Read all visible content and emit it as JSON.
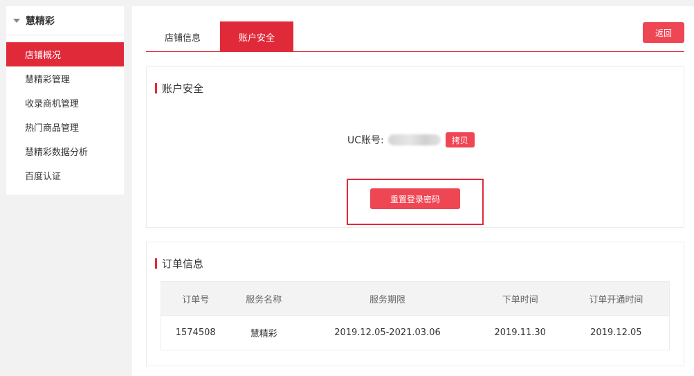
{
  "sidebar": {
    "header": "慧精彩",
    "items": [
      {
        "label": "店铺概况",
        "active": true
      },
      {
        "label": "慧精彩管理"
      },
      {
        "label": "收录商机管理"
      },
      {
        "label": "热门商品管理"
      },
      {
        "label": "慧精彩数据分析"
      },
      {
        "label": "百度认证"
      }
    ]
  },
  "tabs": [
    {
      "label": "店铺信息"
    },
    {
      "label": "账户安全",
      "active": true
    }
  ],
  "back_label": "返回",
  "security": {
    "title": "账户安全",
    "uc_label": "UC账号:",
    "copy_label": "拷贝",
    "reset_label": "重置登录密码"
  },
  "orders": {
    "title": "订单信息",
    "columns": [
      "订单号",
      "服务名称",
      "服务期限",
      "下单时间",
      "订单开通时间"
    ],
    "rows": [
      [
        "1574508",
        "慧精彩",
        "2019.12.05-2021.03.06",
        "2019.11.30",
        "2019.12.05"
      ]
    ]
  },
  "colors": {
    "accent": "#e02a3a",
    "button": "#ef4654"
  }
}
